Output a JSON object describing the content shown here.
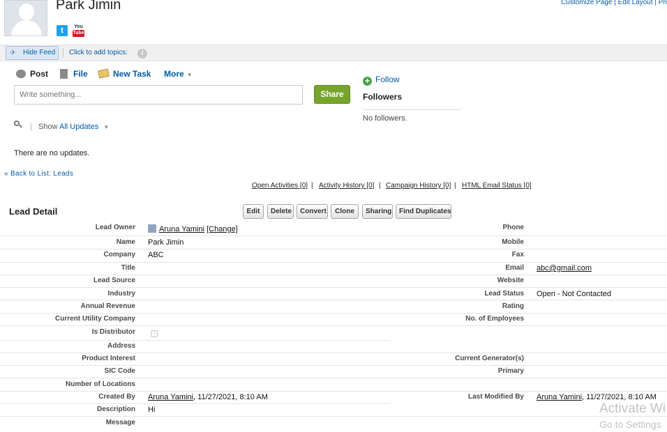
{
  "header": {
    "name": "Park Jimin",
    "top_links": "Customize Page | Edit Layout | Pri"
  },
  "feed_bar": {
    "hide_feed": "Hide Feed",
    "add_topics": "Click to add topics:"
  },
  "publisher": {
    "post": "Post",
    "file": "File",
    "new_task": "New Task",
    "more": "More",
    "placeholder": "Write something...",
    "share": "Share"
  },
  "followers": {
    "follow": "Follow",
    "title": "Followers",
    "empty": "No followers."
  },
  "feed": {
    "show": "Show",
    "filter": "All Updates",
    "empty": "There are no updates."
  },
  "nav": {
    "back": "« Back to List: Leads"
  },
  "related_links": [
    "Open Activities [0]",
    "Activity History [0]",
    "Campaign History [0]",
    "HTML Email Status [0]"
  ],
  "detail": {
    "title": "Lead Detail",
    "buttons": {
      "edit": "Edit",
      "delete": "Delete",
      "convert": "Convert",
      "clone": "Clone",
      "sharing": "Sharing",
      "find_duplicates": "Find Duplicates"
    },
    "left": {
      "lead_owner_label": "Lead Owner",
      "lead_owner_value": "Aruna Yamini",
      "change_link": "[Change]",
      "name_label": "Name",
      "name_value": "Park Jimin",
      "company_label": "Company",
      "company_value": "ABC",
      "title_label": "Title",
      "lead_source_label": "Lead Source",
      "industry_label": "Industry",
      "annual_revenue_label": "Annual Revenue",
      "utility_label": "Current Utility Company",
      "distributor_label": "Is Distributor",
      "address_label": "Address",
      "product_interest_label": "Product Interest",
      "sic_label": "SIC Code",
      "locations_label": "Number of Locations",
      "created_by_label": "Created By",
      "created_by_user": "Aruna Yamini",
      "created_by_date": ", 11/27/2021, 8:10 AM",
      "description_label": "Description",
      "description_value": "Hi",
      "message_label": "Message"
    },
    "right": {
      "phone_label": "Phone",
      "mobile_label": "Mobile",
      "fax_label": "Fax",
      "email_label": "Email",
      "email_value": "abc@gmail.com",
      "website_label": "Website",
      "lead_status_label": "Lead Status",
      "lead_status_value": "Open - Not Contacted",
      "rating_label": "Rating",
      "employees_label": "No. of Employees",
      "generator_label": "Current Generator(s)",
      "primary_label": "Primary",
      "modified_label": "Last Modified By",
      "modified_user": "Aruna Yamini",
      "modified_date": ", 11/27/2021, 8:10 AM"
    }
  },
  "watermark": {
    "line1": "Activate Wi",
    "line2": "Go to Settings"
  }
}
